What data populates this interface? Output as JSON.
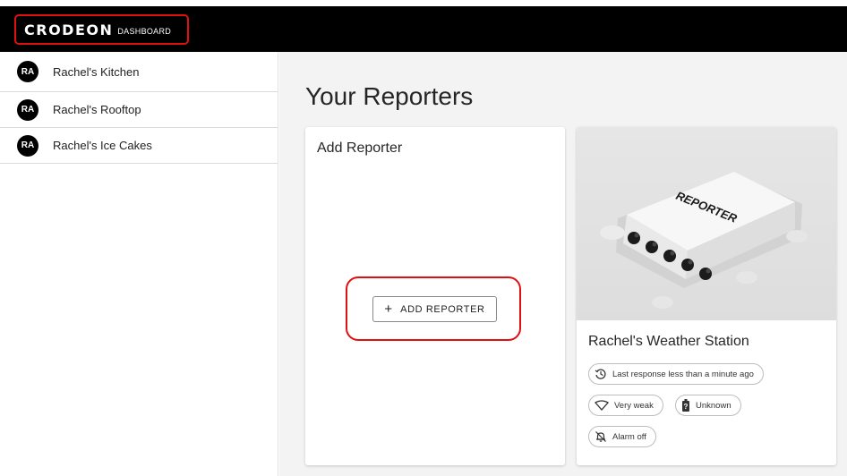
{
  "header": {
    "logo_main": "CRODEON",
    "logo_sub": "DASHBOARD"
  },
  "sidebar": {
    "items": [
      {
        "initials": "RA",
        "label": "Rachel's Kitchen"
      },
      {
        "initials": "RA",
        "label": "Rachel's Rooftop"
      },
      {
        "initials": "RA",
        "label": "Rachel's Ice Cakes"
      }
    ]
  },
  "main": {
    "title": "Your Reporters",
    "add_card": {
      "title": "Add Reporter",
      "button_label": "ADD REPORTER"
    },
    "station_card": {
      "image_brand_text": "REPORTER",
      "name": "Rachel's Weather Station",
      "chips": {
        "last_response": "Last response less than a minute ago",
        "signal": "Very weak",
        "battery": "Unknown",
        "alarm": "Alarm off"
      }
    }
  },
  "icons": {
    "history": "history-icon",
    "signal": "signal-diamond-icon",
    "battery": "battery-unknown-icon",
    "alarm": "bell-off-icon",
    "add": "plus-icon"
  },
  "colors": {
    "header_bg": "#000000",
    "highlight": "#e01010",
    "main_bg": "#f3f3f3",
    "avatar_bg": "#000000"
  }
}
